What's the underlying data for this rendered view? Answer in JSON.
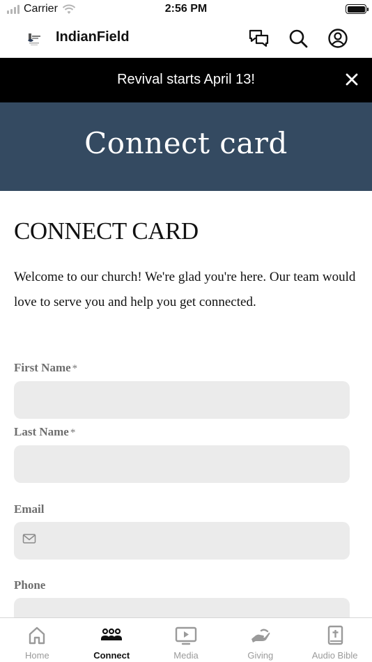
{
  "status_bar": {
    "carrier": "Carrier",
    "time": "2:56 PM"
  },
  "header": {
    "app_title": "IndianField",
    "icons": [
      "chat-icon",
      "search-icon",
      "account-icon"
    ]
  },
  "announcement": {
    "text": "Revival starts April 13!"
  },
  "hero": {
    "title": "Connect card"
  },
  "content": {
    "heading": "CONNECT CARD",
    "intro": "Welcome to our church! We're glad you're here. Our team would love to serve you and help you get connected."
  },
  "form": {
    "first_name": {
      "label": "First Name",
      "required": "*",
      "value": "",
      "placeholder": ""
    },
    "last_name": {
      "label": "Last Name",
      "required": "*",
      "value": "",
      "placeholder": ""
    },
    "email": {
      "label": "Email",
      "value": "",
      "placeholder": "",
      "icon": "mail-icon"
    },
    "phone": {
      "label": "Phone",
      "value": "",
      "placeholder": ""
    }
  },
  "tabs": [
    {
      "label": "Home",
      "icon": "home-icon",
      "active": false
    },
    {
      "label": "Connect",
      "icon": "people-icon",
      "active": true
    },
    {
      "label": "Media",
      "icon": "play-screen-icon",
      "active": false
    },
    {
      "label": "Giving",
      "icon": "giving-hand-icon",
      "active": false
    },
    {
      "label": "Audio Bible",
      "icon": "bible-icon",
      "active": false
    }
  ],
  "colors": {
    "hero_bg": "#344a61",
    "banner_bg": "#000000",
    "input_bg": "#ebebeb",
    "label_gray": "#6e6e6e",
    "tab_inactive": "#9a9a9a"
  }
}
